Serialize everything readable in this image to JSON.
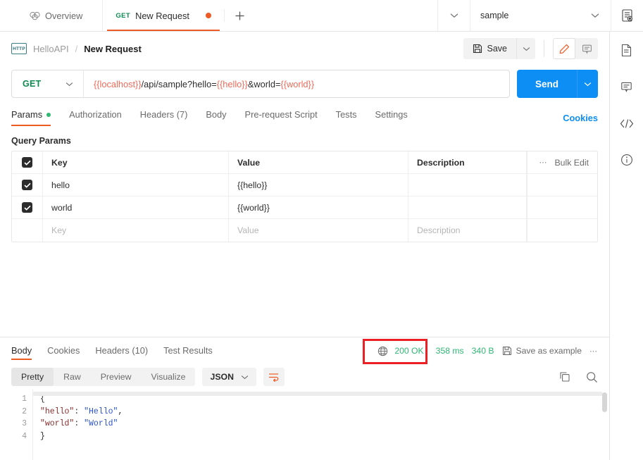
{
  "tabbar": {
    "overview_label": "Overview",
    "request_tab": {
      "method": "GET",
      "label": "New Request",
      "unsaved": true
    },
    "new_tab_label": "+",
    "environment": "sample"
  },
  "request_header": {
    "protocol_badge": "HTTP",
    "collection": "HelloAPI",
    "separator": "/",
    "request_name": "New Request",
    "save_label": "Save"
  },
  "url_bar": {
    "method": "GET",
    "url_parts": [
      {
        "text": "{{localhost}}",
        "variable": true
      },
      {
        "text": "/api/sample?hello=",
        "variable": false
      },
      {
        "text": "{{hello}}",
        "variable": true
      },
      {
        "text": "&world=",
        "variable": false
      },
      {
        "text": "{{world}}",
        "variable": true
      }
    ],
    "url_full": "{{localhost}}/api/sample?hello={{hello}}&world={{world}}",
    "send_label": "Send"
  },
  "request_tabs": {
    "items": [
      {
        "label": "Params",
        "active": true,
        "dot": true
      },
      {
        "label": "Authorization",
        "active": false,
        "dot": false
      },
      {
        "label": "Headers (7)",
        "active": false,
        "dot": false
      },
      {
        "label": "Body",
        "active": false,
        "dot": false
      },
      {
        "label": "Pre-request Script",
        "active": false,
        "dot": false
      },
      {
        "label": "Tests",
        "active": false,
        "dot": false
      },
      {
        "label": "Settings",
        "active": false,
        "dot": false
      }
    ],
    "cookies_link": "Cookies"
  },
  "query_params": {
    "section_title": "Query Params",
    "columns": [
      "Key",
      "Value",
      "Description"
    ],
    "bulk_edit_label": "Bulk Edit",
    "rows": [
      {
        "checked": true,
        "key": "hello",
        "value": "{{hello}}",
        "description": "",
        "value_is_variable": true
      },
      {
        "checked": true,
        "key": "world",
        "value": "{{world}}",
        "description": "",
        "value_is_variable": true
      }
    ],
    "placeholder_row": {
      "key": "Key",
      "value": "Value",
      "description": "Description"
    }
  },
  "response": {
    "tabs": [
      {
        "label": "Body",
        "active": true
      },
      {
        "label": "Cookies",
        "active": false
      },
      {
        "label": "Headers (10)",
        "active": false
      },
      {
        "label": "Test Results",
        "active": false
      }
    ],
    "status": "200 OK",
    "time": "358 ms",
    "size": "340 B",
    "save_as_example": "Save as example",
    "more_label": "...",
    "highlight_color": "#ec2024"
  },
  "viewer": {
    "modes": [
      {
        "label": "Pretty",
        "selected": true
      },
      {
        "label": "Raw",
        "selected": false
      },
      {
        "label": "Preview",
        "selected": false
      },
      {
        "label": "Visualize",
        "selected": false
      }
    ],
    "format": "JSON",
    "code_lines": [
      {
        "num": "1",
        "tokens": [
          {
            "t": "{",
            "c": "jpunc"
          }
        ]
      },
      {
        "num": "2",
        "tokens": [
          {
            "t": "    ",
            "c": "jpunc"
          },
          {
            "t": "\"hello\"",
            "c": "jkey"
          },
          {
            "t": ": ",
            "c": "jpunc"
          },
          {
            "t": "\"Hello\"",
            "c": "jstr"
          },
          {
            "t": ",",
            "c": "jpunc"
          }
        ]
      },
      {
        "num": "3",
        "tokens": [
          {
            "t": "    ",
            "c": "jpunc"
          },
          {
            "t": "\"world\"",
            "c": "jkey"
          },
          {
            "t": ": ",
            "c": "jpunc"
          },
          {
            "t": "\"World\"",
            "c": "jstr"
          }
        ]
      },
      {
        "num": "4",
        "tokens": [
          {
            "t": "}",
            "c": "jpunc"
          }
        ]
      }
    ]
  },
  "colors": {
    "accent_orange": "#ef5b25",
    "send_blue": "#0d8ef5",
    "green": "#2eb872",
    "method_green": "#0d8a4f",
    "variable_red": "#ef6b5a",
    "highlight_red": "#ec2024"
  }
}
